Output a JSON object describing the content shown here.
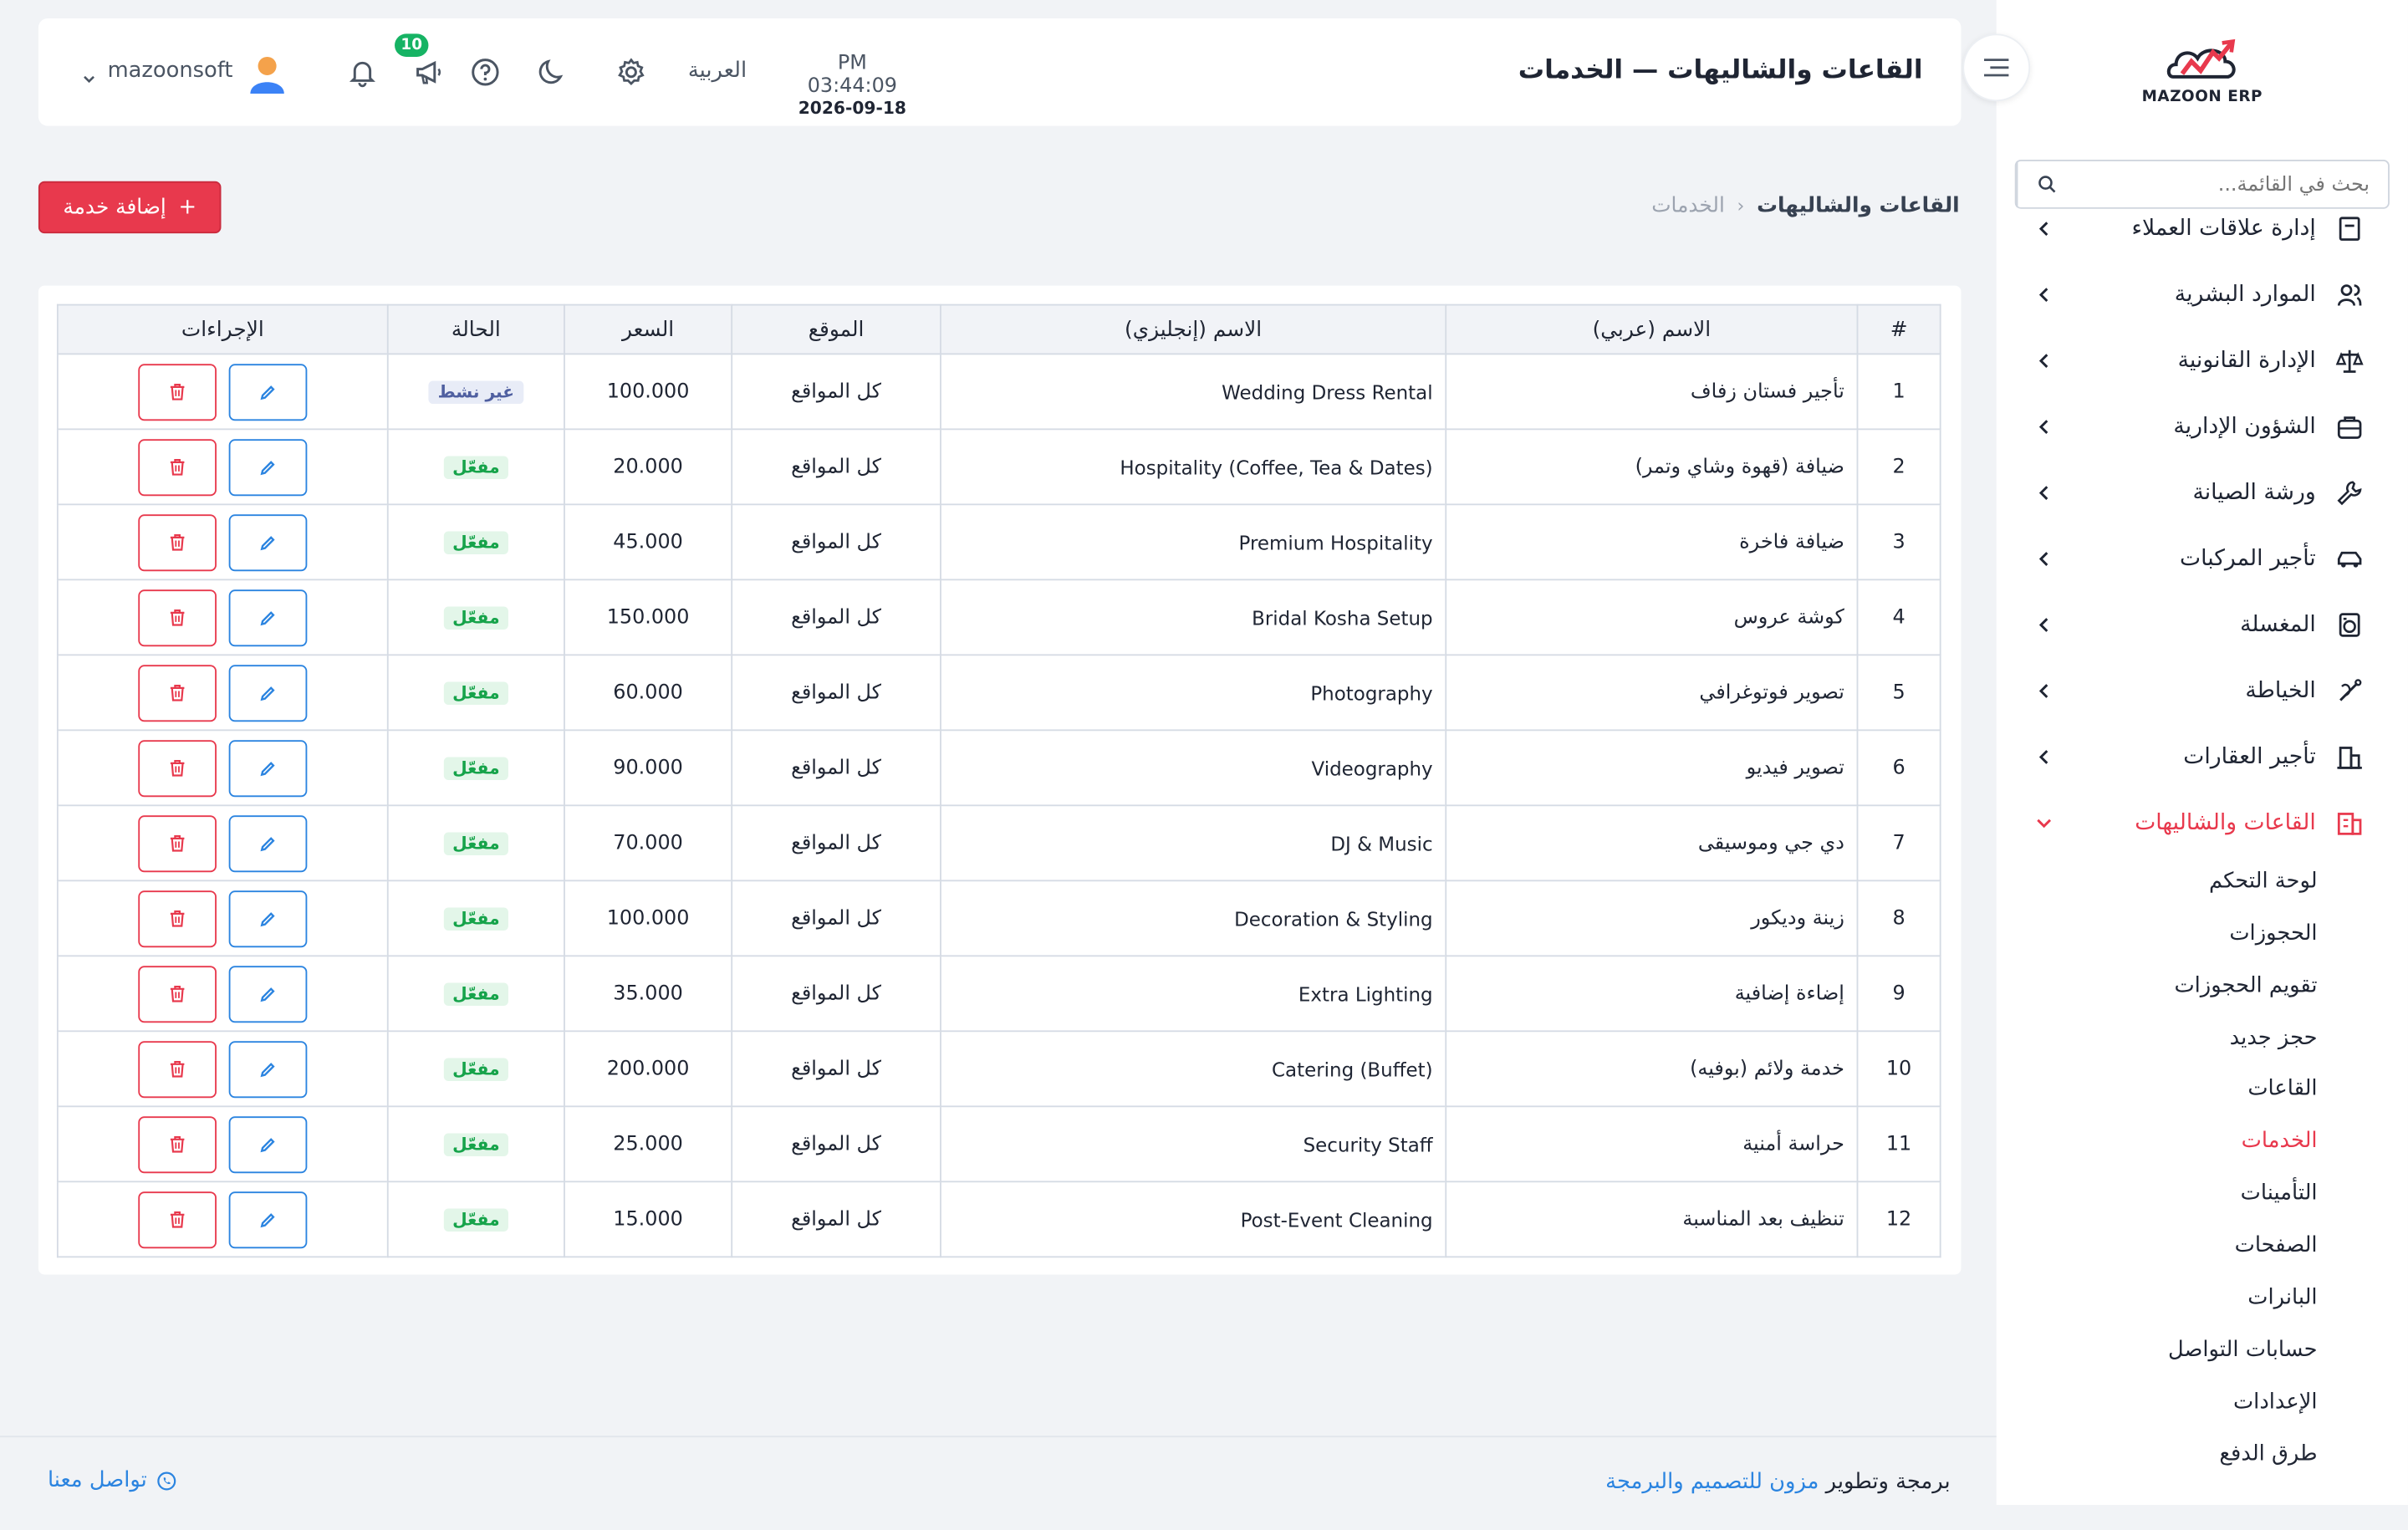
{
  "header": {
    "title": "القاعات والشاليهات — الخدمات",
    "time": "PM 03:44:09",
    "date": "2026-09-18",
    "language": "العربية",
    "notification_count": "10",
    "username": "mazoonsoft"
  },
  "sidebar": {
    "logo_text": "MAZOON ERP",
    "search_placeholder": "بحث في القائمة...",
    "items": [
      {
        "label": "إدارة علاقات العملاء",
        "icon": "crm-icon"
      },
      {
        "label": "الموارد البشرية",
        "icon": "users-icon"
      },
      {
        "label": "الإدارة القانونية",
        "icon": "scale-icon"
      },
      {
        "label": "الشؤون الإدارية",
        "icon": "briefcase-icon"
      },
      {
        "label": "ورشة الصيانة",
        "icon": "wrench-icon"
      },
      {
        "label": "تأجير المركبات",
        "icon": "car-icon"
      },
      {
        "label": "المغسلة",
        "icon": "washer-icon"
      },
      {
        "label": "الخياطة",
        "icon": "needle-icon"
      },
      {
        "label": "تأجير العقارات",
        "icon": "building-icon"
      },
      {
        "label": "القاعات والشاليهات",
        "icon": "hall-icon"
      }
    ],
    "sub_items": [
      "لوحة التحكم",
      "الحجوزات",
      "تقويم الحجوزات",
      "حجز جديد",
      "القاعات",
      "الخدمات",
      "التأمينات",
      "الصفحات",
      "البانرات",
      "حسابات التواصل",
      "الإعدادات",
      "طرق الدفع"
    ]
  },
  "breadcrumb": {
    "section": "القاعات والشاليهات",
    "page": "الخدمات"
  },
  "add_button": "إضافة خدمة",
  "table": {
    "headers": [
      "#",
      "الاسم (عربي)",
      "الاسم (إنجليزي)",
      "الموقع",
      "السعر",
      "الحالة",
      "الإجراءات"
    ],
    "rows": [
      {
        "num": "1",
        "ar": "تأجير فستان زفاف",
        "en": "Wedding Dress Rental",
        "loc": "كل المواقع",
        "price": "100.000",
        "status": "غير نشط",
        "active": false
      },
      {
        "num": "2",
        "ar": "ضيافة (قهوة وشاي وتمر)",
        "en": "Hospitality (Coffee, Tea & Dates)",
        "loc": "كل المواقع",
        "price": "20.000",
        "status": "مفعّل",
        "active": true
      },
      {
        "num": "3",
        "ar": "ضيافة فاخرة",
        "en": "Premium Hospitality",
        "loc": "كل المواقع",
        "price": "45.000",
        "status": "مفعّل",
        "active": true
      },
      {
        "num": "4",
        "ar": "كوشة عروس",
        "en": "Bridal Kosha Setup",
        "loc": "كل المواقع",
        "price": "150.000",
        "status": "مفعّل",
        "active": true
      },
      {
        "num": "5",
        "ar": "تصوير فوتوغرافي",
        "en": "Photography",
        "loc": "كل المواقع",
        "price": "60.000",
        "status": "مفعّل",
        "active": true
      },
      {
        "num": "6",
        "ar": "تصوير فيديو",
        "en": "Videography",
        "loc": "كل المواقع",
        "price": "90.000",
        "status": "مفعّل",
        "active": true
      },
      {
        "num": "7",
        "ar": "دي جي وموسيقى",
        "en": "DJ & Music",
        "loc": "كل المواقع",
        "price": "70.000",
        "status": "مفعّل",
        "active": true
      },
      {
        "num": "8",
        "ar": "زينة وديكور",
        "en": "Decoration & Styling",
        "loc": "كل المواقع",
        "price": "100.000",
        "status": "مفعّل",
        "active": true
      },
      {
        "num": "9",
        "ar": "إضاءة إضافية",
        "en": "Extra Lighting",
        "loc": "كل المواقع",
        "price": "35.000",
        "status": "مفعّل",
        "active": true
      },
      {
        "num": "10",
        "ar": "خدمة ولائم (بوفيه)",
        "en": "Catering (Buffet)",
        "loc": "كل المواقع",
        "price": "200.000",
        "status": "مفعّل",
        "active": true
      },
      {
        "num": "11",
        "ar": "حراسة أمنية",
        "en": "Security Staff",
        "loc": "كل المواقع",
        "price": "25.000",
        "status": "مفعّل",
        "active": true
      },
      {
        "num": "12",
        "ar": "تنظيف بعد المناسبة",
        "en": "Post-Event Cleaning",
        "loc": "كل المواقع",
        "price": "15.000",
        "status": "مفعّل",
        "active": true
      }
    ]
  },
  "footer": {
    "credit_prefix": "برمجة وتطوير",
    "credit_link": "مزون للتصميم والبرمجة",
    "contact": "تواصل معنا"
  },
  "colors": {
    "accent": "#e8394d",
    "link": "#2b84e0",
    "success": "#16a34a"
  }
}
